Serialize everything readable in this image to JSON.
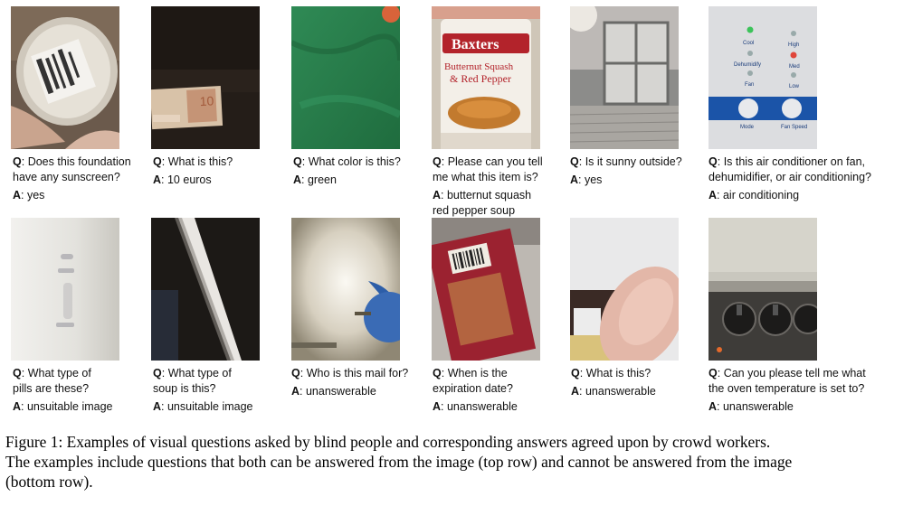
{
  "figure": {
    "caption": [
      "Figure 1: Examples of visual questions asked by blind people and corresponding answers agreed upon by crowd workers.",
      "The examples include questions that both can be answered from the image (top row) and cannot be answered from the image",
      "(bottom row)."
    ],
    "top_row": [
      {
        "q_lines": [
          "Does this foundation",
          "have any sunscreen?"
        ],
        "a_lines": [
          "yes"
        ]
      },
      {
        "q_lines": [
          "What is this?"
        ],
        "a_lines": [
          "10 euros"
        ],
        "image_text": {
          "bill_number": "10",
          "brand": ""
        }
      },
      {
        "q_lines": [
          "What color is this?"
        ],
        "a_lines": [
          "green"
        ]
      },
      {
        "q_lines": [
          "Please can you tell",
          "me what this item is?"
        ],
        "a_lines": [
          "butternut squash",
          "red pepper soup"
        ],
        "image_text": {
          "brand": "Baxters",
          "label1": "Butternut Squash",
          "label2": "& Red Pepper"
        }
      },
      {
        "q_lines": [
          "Is it sunny outside?"
        ],
        "a_lines": [
          "yes"
        ]
      },
      {
        "q_lines": [
          "Is this air conditioner on fan,",
          "dehumidifier, or air conditioning?"
        ],
        "a_lines": [
          "air conditioning"
        ],
        "image_text": {
          "cool": "Cool",
          "dehumidify": "Dehumidify",
          "fan": "Fan",
          "high": "High",
          "med": "Med",
          "low": "Low",
          "mode": "Mode",
          "fan_speed": "Fan Speed"
        }
      }
    ],
    "bottom_row": [
      {
        "q_lines": [
          "What type of",
          "pills are these?"
        ],
        "a_lines": [
          "unsuitable image"
        ]
      },
      {
        "q_lines": [
          "What type of",
          "soup is this?"
        ],
        "a_lines": [
          "unsuitable image"
        ]
      },
      {
        "q_lines": [
          "Who is this mail for?"
        ],
        "a_lines": [
          "unanswerable"
        ]
      },
      {
        "q_lines": [
          "When is the",
          "expiration date?"
        ],
        "a_lines": [
          "unanswerable"
        ]
      },
      {
        "q_lines": [
          "What is this?"
        ],
        "a_lines": [
          "unanswerable"
        ]
      },
      {
        "q_lines": [
          "Can you please tell me what",
          "the oven temperature is set to?"
        ],
        "a_lines": [
          "unanswerable"
        ]
      }
    ],
    "labels": {
      "q": "Q",
      "a": "A"
    }
  }
}
